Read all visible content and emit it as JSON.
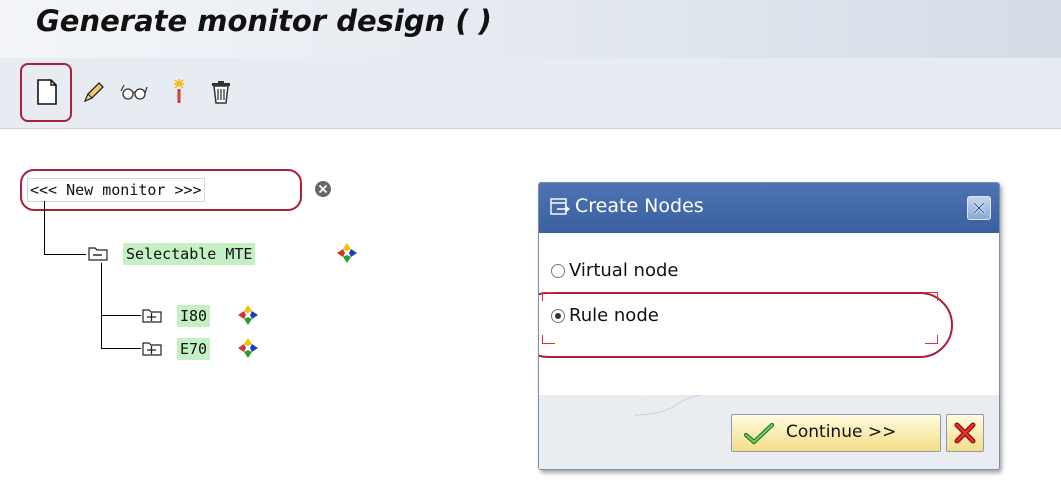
{
  "page": {
    "title": "Generate monitor design (  )"
  },
  "toolbar": {
    "buttons": [
      {
        "icon": "new-document-icon"
      },
      {
        "icon": "pencil-edit-icon"
      },
      {
        "icon": "glasses-display-icon"
      },
      {
        "icon": "magic-wand-icon"
      },
      {
        "icon": "trash-delete-icon"
      }
    ]
  },
  "tree": {
    "root": {
      "label": "<<< New monitor >>>"
    },
    "child": {
      "label": "Selectable MTE"
    },
    "leaves": [
      {
        "label": "I80"
      },
      {
        "label": "E70"
      }
    ]
  },
  "dialog": {
    "title": "Create Nodes",
    "options": [
      {
        "label": "Virtual node",
        "checked": false
      },
      {
        "label": "Rule node",
        "checked": true
      }
    ],
    "continue_label": "Continue >>"
  },
  "colors": {
    "highlight_green": "#c4f0c4",
    "annotation_red": "#a8203a",
    "dialog_title_blue": "#3a5f9f",
    "button_yellow": "#f4de88"
  }
}
